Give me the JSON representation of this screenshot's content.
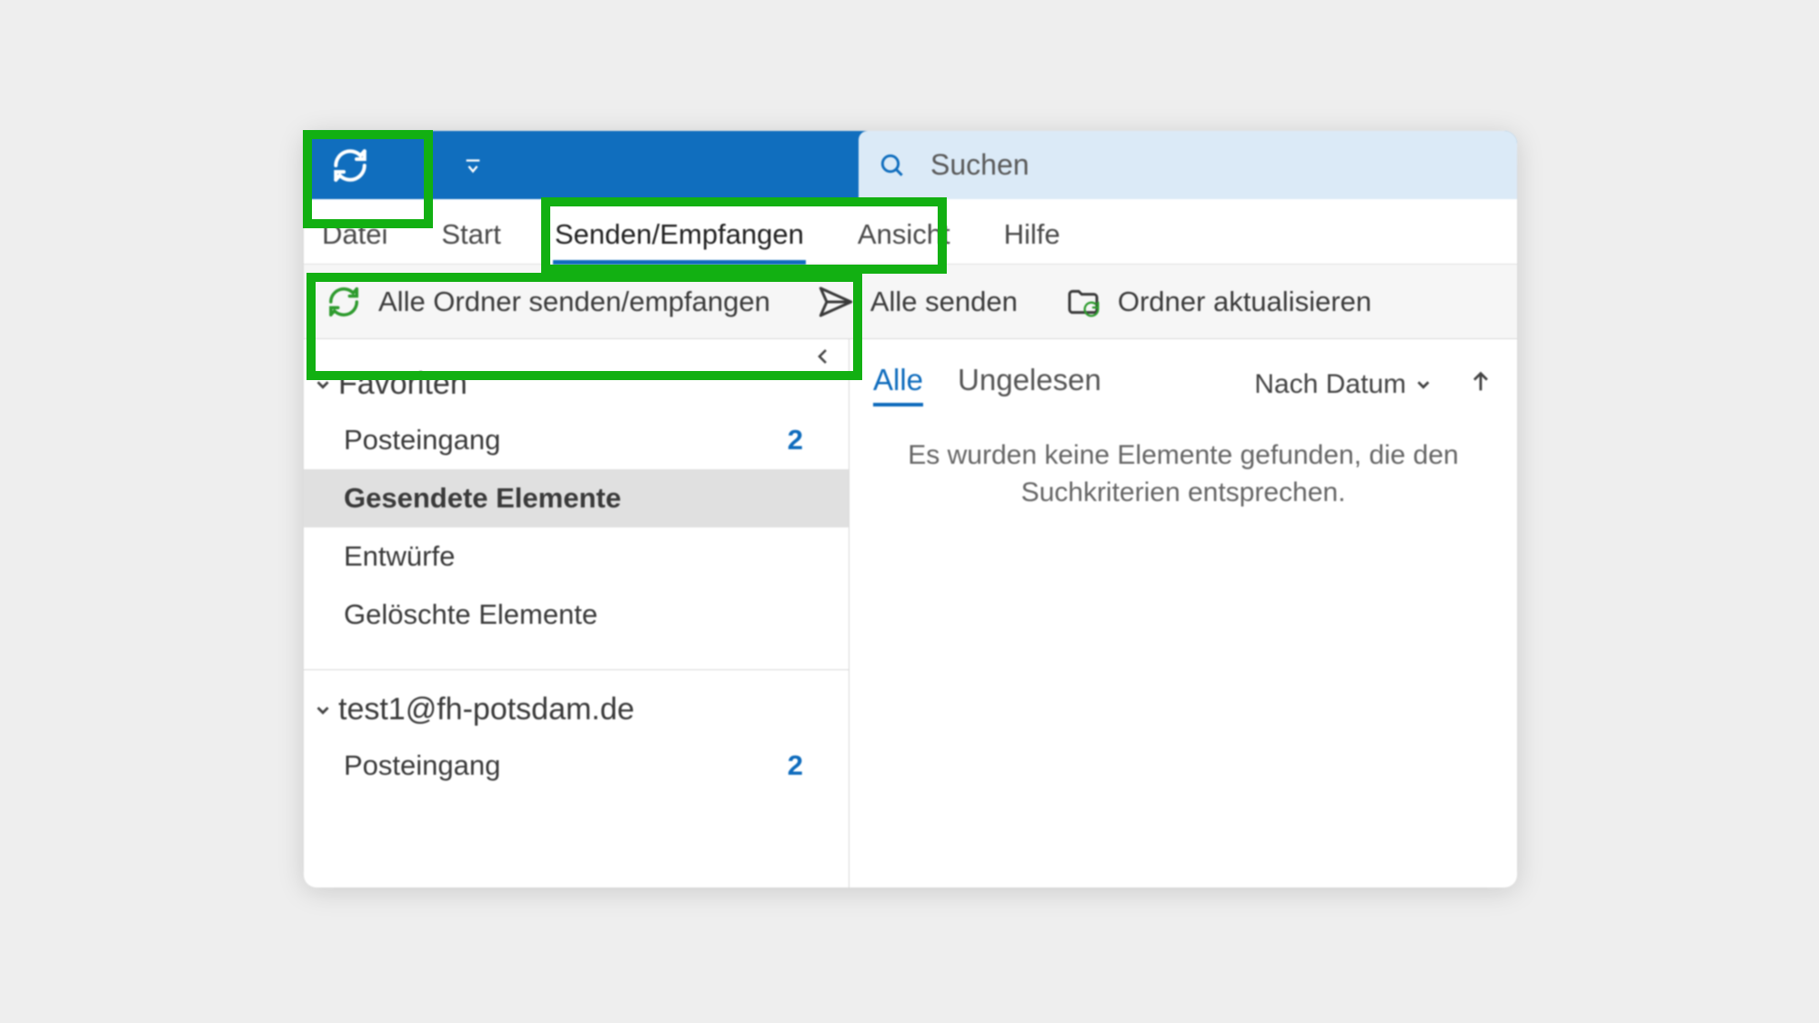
{
  "search": {
    "placeholder": "Suchen"
  },
  "tabs": {
    "datei": "Datei",
    "start": "Start",
    "senden_empfangen": "Senden/Empfangen",
    "ansicht": "Ansicht",
    "hilfe": "Hilfe"
  },
  "toolbar": {
    "send_receive_all": "Alle Ordner senden/empfangen",
    "send_all": "Alle senden",
    "update_folder": "Ordner aktualisieren"
  },
  "nav": {
    "favorites_header": "Favoriten",
    "account_header": "test1@fh-potsdam.de",
    "items": {
      "inbox": {
        "label": "Posteingang",
        "count": "2"
      },
      "sent": {
        "label": "Gesendete Elemente"
      },
      "drafts": {
        "label": "Entwürfe"
      },
      "deleted": {
        "label": "Gelöschte Elemente"
      },
      "inbox2": {
        "label": "Posteingang",
        "count": "2"
      }
    }
  },
  "list": {
    "filter_all": "Alle",
    "filter_unread": "Ungelesen",
    "sort_label": "Nach Datum",
    "empty_line1": "Es wurden keine Elemente gefunden, die den",
    "empty_line2": "Suchkriterien entsprechen."
  },
  "colors": {
    "accent": "#0f6cbd",
    "highlight": "#12b012",
    "titlebar": "#106ebe"
  }
}
